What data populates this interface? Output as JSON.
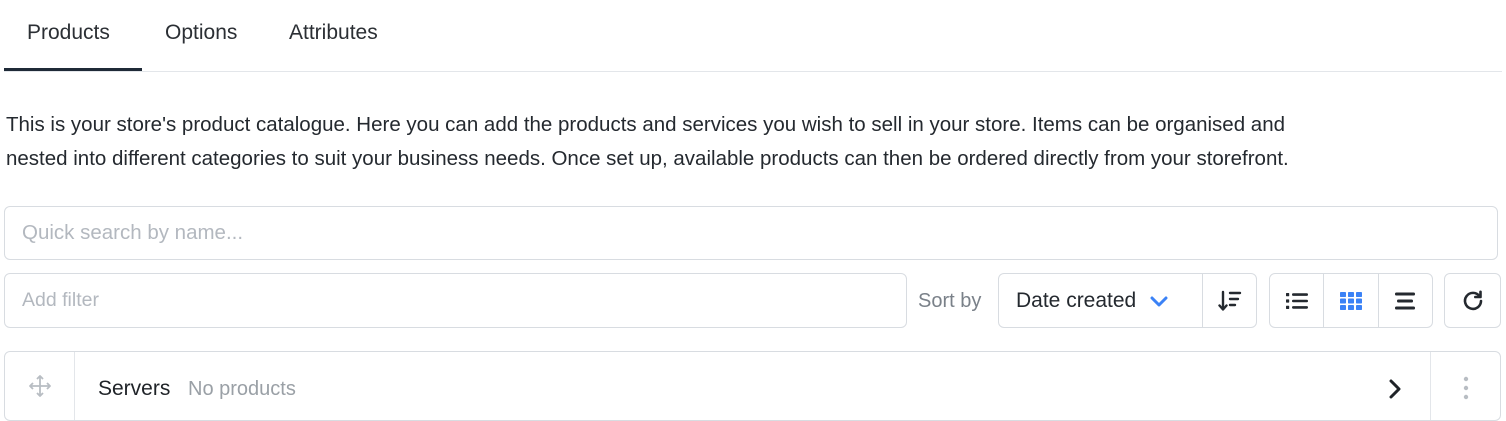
{
  "tabs": [
    {
      "label": "Products",
      "active": true
    },
    {
      "label": "Options",
      "active": false
    },
    {
      "label": "Attributes",
      "active": false
    }
  ],
  "description": {
    "line1": "This is your store's product catalogue. Here you can add the products and services you wish to sell in your store. Items can be organised and",
    "line2": "nested into different categories to suit your business needs. Once set up, available products can then be ordered directly from your storefront."
  },
  "search": {
    "placeholder": "Quick search by name...",
    "value": ""
  },
  "filter": {
    "placeholder": "Add filter",
    "value": ""
  },
  "sort": {
    "label": "Sort by",
    "selected": "Date created",
    "direction_icon": "sort-descending-icon"
  },
  "view_modes": [
    {
      "icon": "list-view-icon",
      "active": false
    },
    {
      "icon": "grid-view-icon",
      "active": true
    },
    {
      "icon": "compact-view-icon",
      "active": false
    }
  ],
  "refresh_icon": "refresh-icon",
  "categories": [
    {
      "name": "Servers",
      "count_text": "No products"
    }
  ],
  "colors": {
    "accent": "#3b82f6",
    "text": "#24292f",
    "muted": "#9aa0a6",
    "border": "#d8dce1",
    "tab_underline": "#1f2a37"
  }
}
